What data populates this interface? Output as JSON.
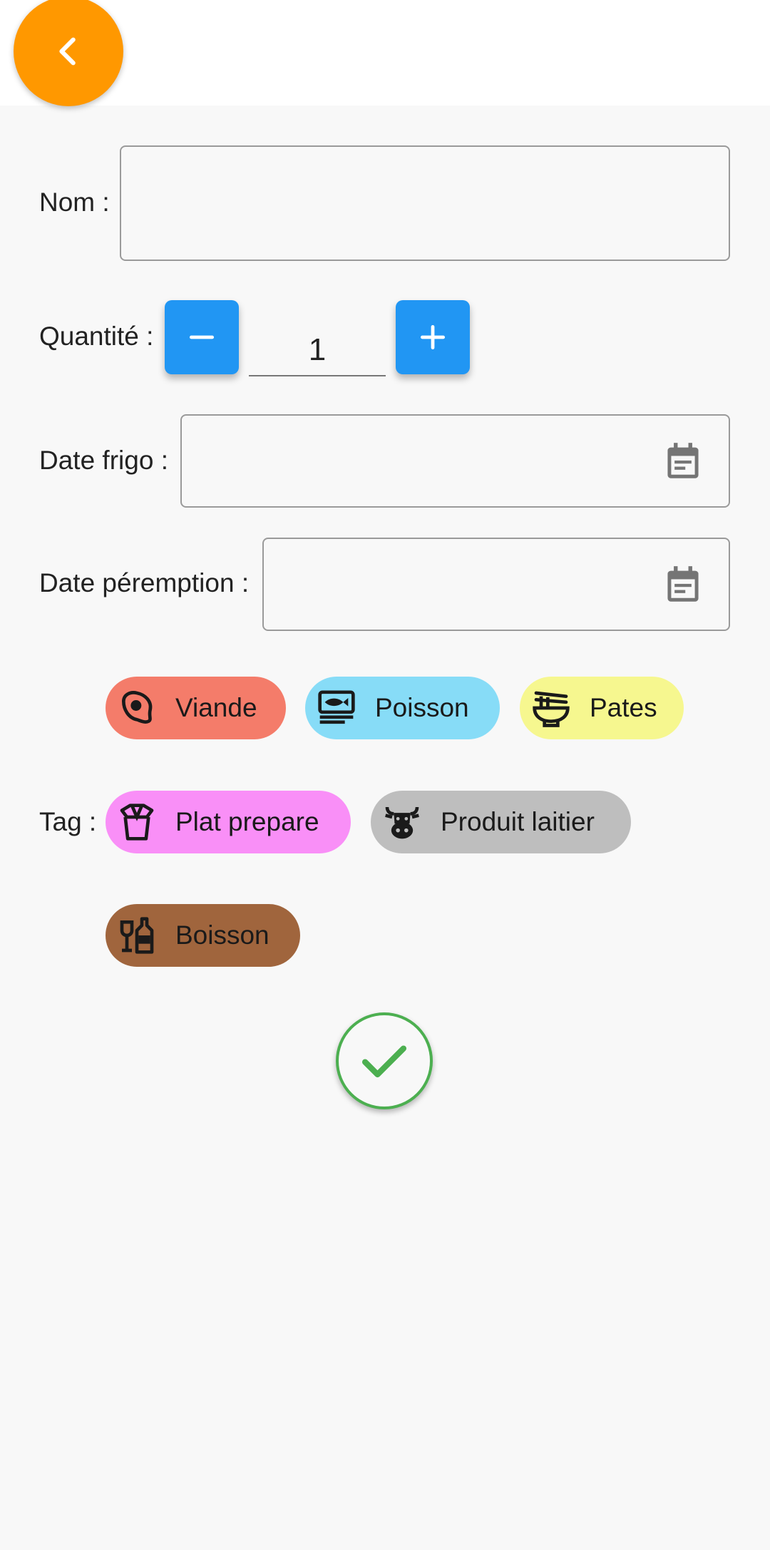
{
  "header": {
    "back_icon": "chevron-left-icon",
    "accent": "#ff9800"
  },
  "form": {
    "nom_label": "Nom :",
    "nom_value": "",
    "quantite_label": "Quantité :",
    "quantite_value": "1",
    "date_frigo_label": "Date frigo :",
    "date_frigo_value": "",
    "date_peremption_label": "Date péremption :",
    "date_peremption_value": "",
    "tag_label": "Tag :"
  },
  "tags": [
    {
      "label": "Viande",
      "color": "#f47c6a",
      "icon": "meat-icon"
    },
    {
      "label": "Poisson",
      "color": "#87dcf7",
      "icon": "fish-icon"
    },
    {
      "label": "Pates",
      "color": "#f6f78f",
      "icon": "noodle-bowl-icon"
    },
    {
      "label": "Plat prepare",
      "color": "#f98ff7",
      "icon": "takeout-box-icon"
    },
    {
      "label": "Produit laitier",
      "color": "#bebebe",
      "icon": "cow-icon"
    },
    {
      "label": "Boisson",
      "color": "#a0653d",
      "icon": "bottle-glass-icon"
    }
  ],
  "colors": {
    "stepper": "#2196f3",
    "confirm": "#4caf50"
  }
}
